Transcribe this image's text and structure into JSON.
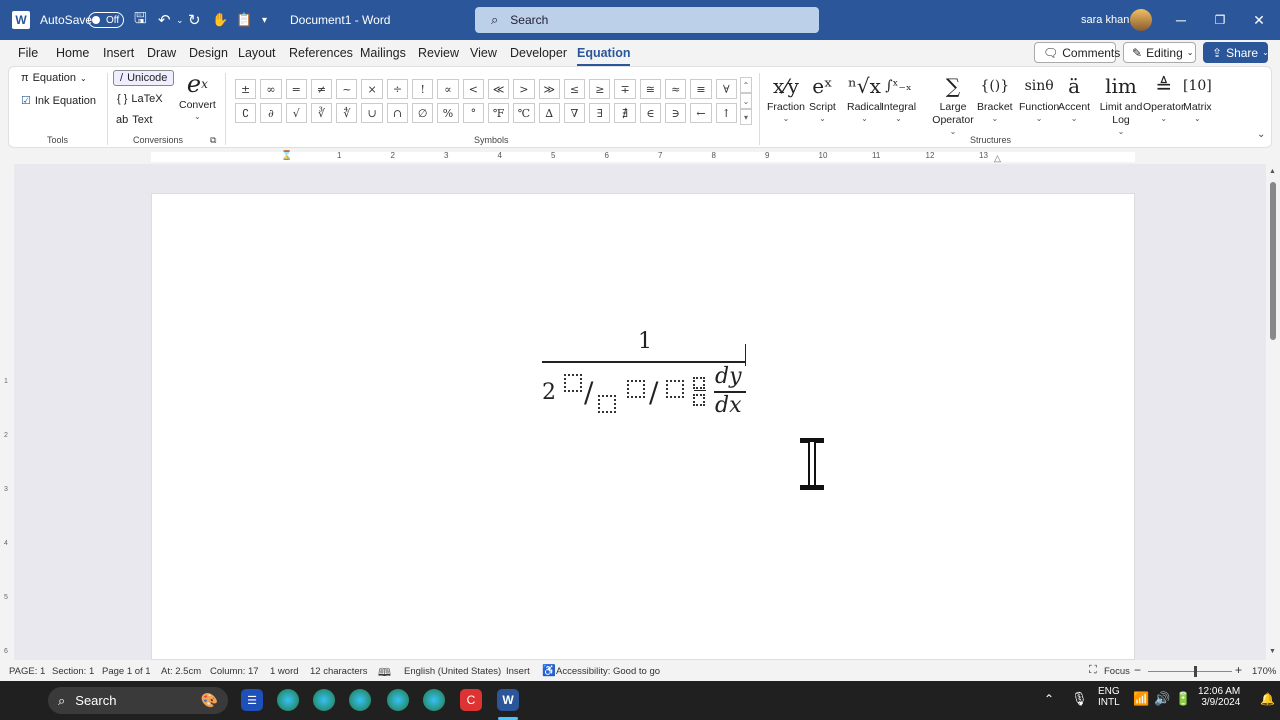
{
  "titlebar": {
    "autosave_label": "AutoSave",
    "autosave_state": "Off",
    "document_title": "Document1  -  Word",
    "search_placeholder": "Search",
    "user_name": "sara khan",
    "word_logo": "W"
  },
  "tabs": [
    "File",
    "Home",
    "Insert",
    "Draw",
    "Design",
    "Layout",
    "References",
    "Mailings",
    "Review",
    "View",
    "Developer",
    "Equation"
  ],
  "active_tab": "Equation",
  "buttons": {
    "comments": "Comments",
    "editing": "Editing",
    "share": "Share"
  },
  "ribbon": {
    "tools": {
      "equation": "Equation",
      "ink_equation": "Ink Equation",
      "label": "Tools"
    },
    "conversions": {
      "unicode": "Unicode",
      "latex": "LaTeX",
      "text": "Text",
      "convert": "Convert",
      "label": "Conversions"
    },
    "symbols": {
      "label": "Symbols",
      "row1": [
        "±",
        "∞",
        "=",
        "≠",
        "~",
        "×",
        "÷",
        "!",
        "∝",
        "<",
        "≪",
        ">",
        "≫",
        "≤",
        "≥",
        "∓",
        "≅",
        "≈",
        "≡",
        "∀"
      ],
      "row2": [
        "∁",
        "∂",
        "√",
        "∛",
        "∜",
        "∪",
        "∩",
        "∅",
        "%",
        "°",
        "℉",
        "℃",
        "∆",
        "∇",
        "∃",
        "∄",
        "∈",
        "∋",
        "←",
        "↑"
      ]
    },
    "structures": {
      "label": "Structures",
      "items": [
        {
          "label": "Fraction",
          "glyph": "x⁄y"
        },
        {
          "label": "Script",
          "glyph": "eˣ"
        },
        {
          "label": "Radical",
          "glyph": "ⁿ√x"
        },
        {
          "label": "Integral",
          "glyph": "∫ˣ₋ₓ"
        },
        {
          "label": "Large Operator",
          "glyph": "∑"
        },
        {
          "label": "Bracket",
          "glyph": "{()}"
        },
        {
          "label": "Function",
          "glyph": "sinθ"
        },
        {
          "label": "Accent",
          "glyph": "ä"
        },
        {
          "label": "Limit and Log",
          "glyph": "lim"
        },
        {
          "label": "Operator",
          "glyph": "≜"
        },
        {
          "label": "Matrix",
          "glyph": "[10]"
        }
      ]
    }
  },
  "ruler_numbers": [
    "1",
    "2",
    "3",
    "4",
    "5",
    "6",
    "7",
    "8",
    "9",
    "10",
    "11",
    "12",
    "13"
  ],
  "vruler_numbers": [
    "1",
    "2",
    "3",
    "4",
    "5",
    "6"
  ],
  "equation": {
    "numerator": "1",
    "base": "2",
    "slash": "/",
    "dy": "dy",
    "dx": "dx"
  },
  "status": {
    "page": "PAGE: 1",
    "section": "Section: 1",
    "pageof": "Page 1 of 1",
    "at": "At: 2.5cm",
    "column": "Column: 17",
    "words": "1 word",
    "chars": "12 characters",
    "language": "English (United States)",
    "insert": "Insert",
    "accessibility": "Accessibility: Good to go",
    "focus": "Focus",
    "zoom": "170%"
  },
  "taskbar": {
    "search": "Search",
    "lang1": "ENG",
    "lang2": "INTL",
    "time": "12:06 AM",
    "date": "3/9/2024"
  }
}
